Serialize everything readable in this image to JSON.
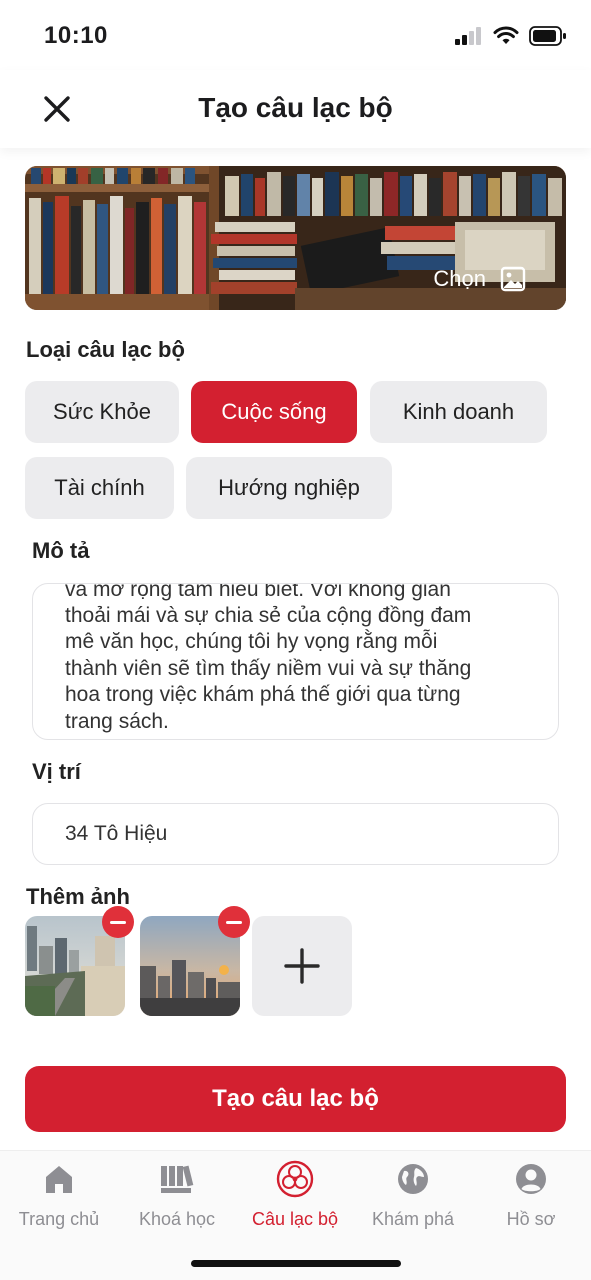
{
  "status_bar": {
    "time": "10:10"
  },
  "header": {
    "title": "Tạo câu lạc bộ",
    "close_icon": "close-icon"
  },
  "cover": {
    "choose_label": "Chọn",
    "icon": "image-icon"
  },
  "club_type": {
    "label": "Loại câu lạc bộ",
    "options": [
      "Sức Khỏe",
      "Cuộc sống",
      "Kinh doanh",
      "Tài chính",
      "Hướng nghiệp"
    ],
    "selected": "Cuộc sống"
  },
  "description": {
    "label": "Mô tả",
    "lines": [
      "và mở rộng tầm hiểu biết. Với không gian",
      "thoải mái và sự chia sẻ của cộng đồng đam",
      "mê văn học, chúng tôi hy vọng rằng mỗi",
      "thành viên sẽ tìm thấy niềm vui và sự thăng",
      "hoa trong việc khám phá thế giới qua từng",
      "trang sách."
    ]
  },
  "location": {
    "label": "Vị trí",
    "value": "34 Tô Hiệu"
  },
  "photos": {
    "label": "Thêm ảnh",
    "add_icon": "plus-icon",
    "remove_icon": "minus-icon"
  },
  "submit": {
    "label": "Tạo câu lạc bộ"
  },
  "tabbar": {
    "items": [
      {
        "label": "Trang chủ",
        "icon": "home-icon"
      },
      {
        "label": "Khoá học",
        "icon": "books-icon"
      },
      {
        "label": "Câu lạc bộ",
        "icon": "club-icon"
      },
      {
        "label": "Khám phá",
        "icon": "globe-icon"
      },
      {
        "label": "Hồ sơ",
        "icon": "profile-icon"
      }
    ],
    "active": "Câu lạc bộ"
  },
  "colors": {
    "accent": "#d32030",
    "chip_bg": "#ececee",
    "remove_badge": "#e0303a"
  }
}
